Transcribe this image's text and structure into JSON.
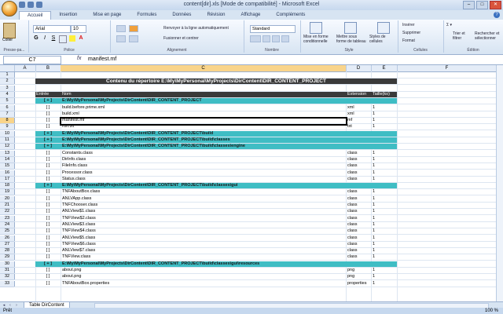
{
  "window": {
    "title": "content[dir].xls [Mode de compatibilité] - Microsoft Excel",
    "controls": [
      "–",
      "□",
      "✕"
    ]
  },
  "ribbon": {
    "tabs": [
      "Accueil",
      "Insertion",
      "Mise en page",
      "Formules",
      "Données",
      "Révision",
      "Affichage",
      "Compléments"
    ],
    "active_tab": "Accueil",
    "paste_label": "Coller",
    "font_name": "Arial",
    "font_size": "10",
    "wrap_text_label": "Renvoyer à la ligne automatiquement",
    "merge_label": "Fusionner et centrer",
    "number_format": "Standard",
    "cond_format_label": "Mise en forme conditionnelle",
    "table_format_label": "Mettre sous forme de tableau",
    "cell_styles_label": "Styles de cellules",
    "insert_label": "Insérer",
    "delete_label": "Supprimer",
    "format_label": "Format",
    "sort_label": "Trier et filtrer",
    "find_label": "Rechercher et sélectionner",
    "groups": [
      "Presse-pa...",
      "Police",
      "Alignement",
      "Nombre",
      "Style",
      "Cellules",
      "Édition"
    ]
  },
  "formula_bar": {
    "name_box": "C7",
    "fx": "fx",
    "content": "manifest.mf"
  },
  "columns": [
    "A",
    "B",
    "C",
    "D",
    "E",
    "F"
  ],
  "header_title": "Contenu du répertoire E:\\My\\MyPersonal\\MyProjects\\DirContent\\DIR_CONTENT_PROJECT",
  "table_headers": {
    "entree": "Entrée",
    "nom": "Nom",
    "extension": "Extension",
    "taille": "Taille(ko)"
  },
  "rows": [
    {
      "n": "1",
      "type": "blank"
    },
    {
      "n": "2",
      "type": "title"
    },
    {
      "n": "3",
      "type": "blank"
    },
    {
      "n": "4",
      "type": "header"
    },
    {
      "n": "5",
      "type": "dir",
      "b": "[ + ]",
      "c": "E:\\My\\MyPersonal\\MyProjects\\DirContent\\DIR_CONTENT_PROJECT"
    },
    {
      "n": "6",
      "type": "file",
      "b": "[ ]",
      "c": "build.before.prime.xml",
      "d": "xml",
      "e": "1"
    },
    {
      "n": "7",
      "type": "file",
      "b": "[ ]",
      "c": "build.xml",
      "d": "xml",
      "e": "1"
    },
    {
      "n": "8",
      "type": "file",
      "b": "[ ]",
      "c": "manifest.mf",
      "d": "mf",
      "e": "1"
    },
    {
      "n": "9",
      "type": "file",
      "b": "[ ]",
      "c": "run.txt",
      "d": "txt",
      "e": "1"
    },
    {
      "n": "10",
      "type": "dir",
      "b": "[ + ]",
      "c": "E:\\My\\MyPersonal\\MyProjects\\DirContent\\DIR_CONTENT_PROJECT\\build"
    },
    {
      "n": "11",
      "type": "dir",
      "b": "[ + ]",
      "c": "E:\\My\\MyPersonal\\MyProjects\\DirContent\\DIR_CONTENT_PROJECT\\build\\classes"
    },
    {
      "n": "12",
      "type": "dir",
      "b": "[ + ]",
      "c": "E:\\My\\MyPersonal\\MyProjects\\DirContent\\DIR_CONTENT_PROJECT\\build\\classes\\engine"
    },
    {
      "n": "13",
      "type": "file",
      "b": "[ ]",
      "c": "Constants.class",
      "d": "class",
      "e": "1"
    },
    {
      "n": "14",
      "type": "file",
      "b": "[ ]",
      "c": "DirInfo.class",
      "d": "class",
      "e": "1"
    },
    {
      "n": "15",
      "type": "file",
      "b": "[ ]",
      "c": "FileInfo.class",
      "d": "class",
      "e": "1"
    },
    {
      "n": "16",
      "type": "file",
      "b": "[ ]",
      "c": "Processor.class",
      "d": "class",
      "e": "1"
    },
    {
      "n": "17",
      "type": "file",
      "b": "[ ]",
      "c": "Status.class",
      "d": "class",
      "e": "1"
    },
    {
      "n": "18",
      "type": "dir",
      "b": "[ + ]",
      "c": "E:\\My\\MyPersonal\\MyProjects\\DirContent\\DIR_CONTENT_PROJECT\\build\\classes\\gui"
    },
    {
      "n": "19",
      "type": "file",
      "b": "[ ]",
      "c": "TNFAboutBox.class",
      "d": "class",
      "e": "1"
    },
    {
      "n": "20",
      "type": "file",
      "b": "[ ]",
      "c": "ANLVApp.class",
      "d": "class",
      "e": "1"
    },
    {
      "n": "21",
      "type": "file",
      "b": "[ ]",
      "c": "TNFChooser.class",
      "d": "class",
      "e": "1"
    },
    {
      "n": "22",
      "type": "file",
      "b": "[ ]",
      "c": "ANLView$1.class",
      "d": "class",
      "e": "1"
    },
    {
      "n": "23",
      "type": "file",
      "b": "[ ]",
      "c": "TNFView$2.class",
      "d": "class",
      "e": "1"
    },
    {
      "n": "24",
      "type": "file",
      "b": "[ ]",
      "c": "ANLView$3.class",
      "d": "class",
      "e": "1"
    },
    {
      "n": "25",
      "type": "file",
      "b": "[ ]",
      "c": "TNFView$4.class",
      "d": "class",
      "e": "1"
    },
    {
      "n": "26",
      "type": "file",
      "b": "[ ]",
      "c": "ANLView$5.class",
      "d": "class",
      "e": "1"
    },
    {
      "n": "27",
      "type": "file",
      "b": "[ ]",
      "c": "TNFView$6.class",
      "d": "class",
      "e": "1"
    },
    {
      "n": "28",
      "type": "file",
      "b": "[ ]",
      "c": "ANLView$7.class",
      "d": "class",
      "e": "1"
    },
    {
      "n": "29",
      "type": "file",
      "b": "[ ]",
      "c": "TNFView.class",
      "d": "class",
      "e": "1"
    },
    {
      "n": "30",
      "type": "dir",
      "b": "[ + ]",
      "c": "E:\\My\\MyPersonal\\MyProjects\\DirContent\\DIR_CONTENT_PROJECT\\build\\classes\\gui\\resources"
    },
    {
      "n": "31",
      "type": "file",
      "b": "[ ]",
      "c": "about.png",
      "d": "png",
      "e": "1"
    },
    {
      "n": "32",
      "type": "file",
      "b": "[ ]",
      "c": "about.png",
      "d": "png",
      "e": "1"
    },
    {
      "n": "33",
      "type": "file",
      "b": "[ ]",
      "c": "TNFAboutBox.properties",
      "d": "properties",
      "e": "1"
    }
  ],
  "sheet_tab": "Table DirContent",
  "status": {
    "mode": "Prêt",
    "zoom": "100 %"
  }
}
